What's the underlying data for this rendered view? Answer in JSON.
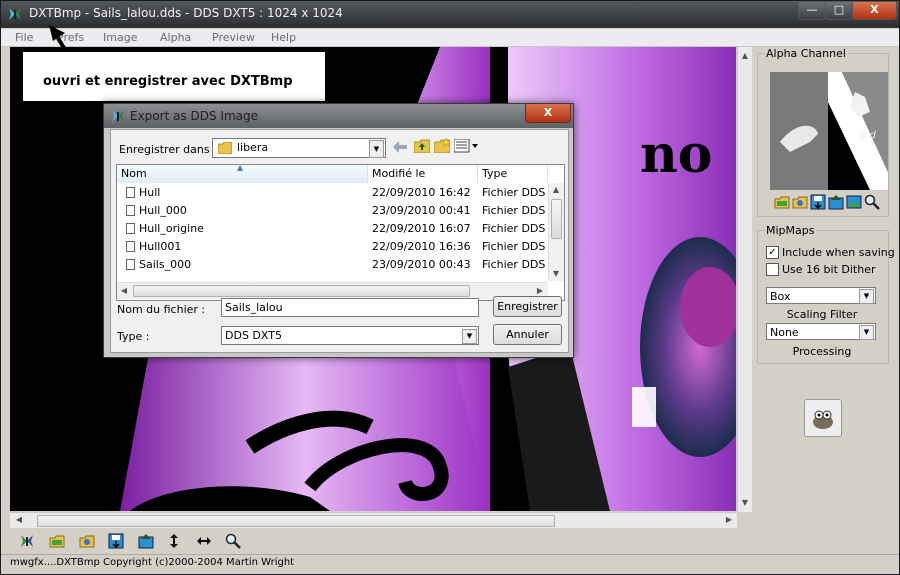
{
  "window": {
    "title": "DXTBmp - Sails_lalou.dds - DDS DXT5 : 1024 x 1024",
    "controls": {
      "minimize": "—",
      "maximize": "□",
      "close": "X"
    }
  },
  "menu": [
    "File",
    "Prefs",
    "Image",
    "Alpha",
    "Preview",
    "Help"
  ],
  "banner_text": "ouvri et enregistrer avec DXTBmp",
  "canvas_text": "no",
  "alpha_panel": {
    "title": "Alpha Channel",
    "preview_letters": "d d",
    "tools": [
      "open-folder-icon",
      "open-image-icon",
      "save-icon",
      "import-icon",
      "picture-icon",
      "zoom-icon"
    ]
  },
  "mipmaps": {
    "title": "MipMaps",
    "include_label": "Include when saving",
    "include_checked": true,
    "dither_label": "Use 16 bit Dither",
    "dither_checked": false,
    "filter_value": "Box",
    "filter_caption": "Scaling Filter",
    "processing_value": "None",
    "processing_caption": "Processing"
  },
  "toolbar_icons": [
    "butterfly-icon",
    "open-folder-icon",
    "open-image-icon",
    "save-icon",
    "export-icon",
    "vertical-arrows-icon",
    "horizontal-arrows-icon",
    "zoom-icon"
  ],
  "status_text": "mwgfx....DXTBmp Copyright (c)2000-2004 Martin Wright",
  "dialog": {
    "title": "Export as DDS Image",
    "close": "X",
    "save_in_label": "Enregistrer dans :",
    "save_in_value": "libera",
    "columns": [
      "Nom",
      "Modifié le",
      "Type"
    ],
    "files": [
      {
        "name": "Hull",
        "modified": "22/09/2010 16:42",
        "type": "Fichier DDS"
      },
      {
        "name": "Hull_000",
        "modified": "23/09/2010 00:41",
        "type": "Fichier DDS"
      },
      {
        "name": "Hull_origine",
        "modified": "22/09/2010 16:07",
        "type": "Fichier DDS"
      },
      {
        "name": "Hull001",
        "modified": "22/09/2010 16:36",
        "type": "Fichier DDS"
      },
      {
        "name": "Sails_000",
        "modified": "23/09/2010 00:43",
        "type": "Fichier DDS"
      }
    ],
    "filename_label": "Nom du fichier :",
    "filename_value": "Sails_lalou",
    "type_label": "Type :",
    "type_value": "DDS DXT5",
    "save_button": "Enregistrer",
    "cancel_button": "Annuler"
  }
}
